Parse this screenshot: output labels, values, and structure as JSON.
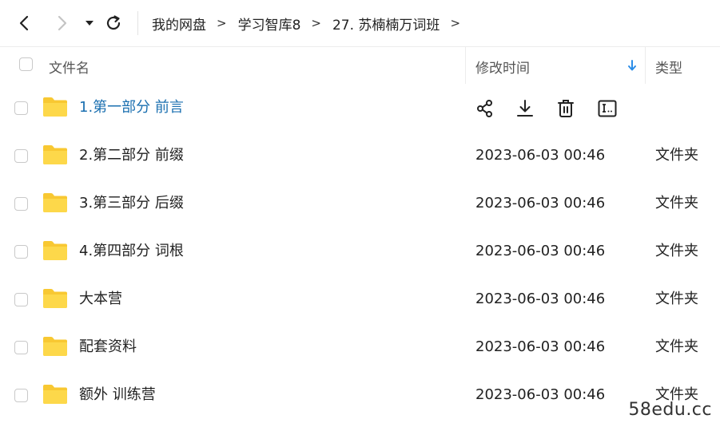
{
  "toolbar": {
    "back_icon": "chevron-left-icon",
    "forward_icon": "chevron-right-icon",
    "history_icon": "caret-down-icon",
    "refresh_icon": "refresh-icon",
    "breadcrumb": [
      "我的网盘",
      "学习智库8",
      "27. 苏楠楠万词班"
    ],
    "separator": ">"
  },
  "header": {
    "name": "文件名",
    "modified": "修改时间",
    "type": "类型",
    "sort_icon": "arrow-down-icon"
  },
  "rows": [
    {
      "name": "1.第一部分 前言",
      "date": "",
      "type": "",
      "hover": true,
      "actions": [
        "share-icon",
        "download-icon",
        "delete-icon",
        "rename-icon"
      ]
    },
    {
      "name": "2.第二部分 前缀",
      "date": "2023-06-03 00:46",
      "type": "文件夹"
    },
    {
      "name": "3.第三部分 后缀",
      "date": "2023-06-03 00:46",
      "type": "文件夹"
    },
    {
      "name": "4.第四部分 词根",
      "date": "2023-06-03 00:46",
      "type": "文件夹"
    },
    {
      "name": "大本营",
      "date": "2023-06-03 00:46",
      "type": "文件夹"
    },
    {
      "name": "配套资料",
      "date": "2023-06-03 00:46",
      "type": "文件夹"
    },
    {
      "name": "额外 训练营",
      "date": "2023-06-03 00:46",
      "type": "文件夹"
    }
  ],
  "watermark": "58edu.cc",
  "colors": {
    "accent": "#1a6fb0",
    "folder": "#f8c832",
    "sort_arrow": "#2b8de8"
  }
}
